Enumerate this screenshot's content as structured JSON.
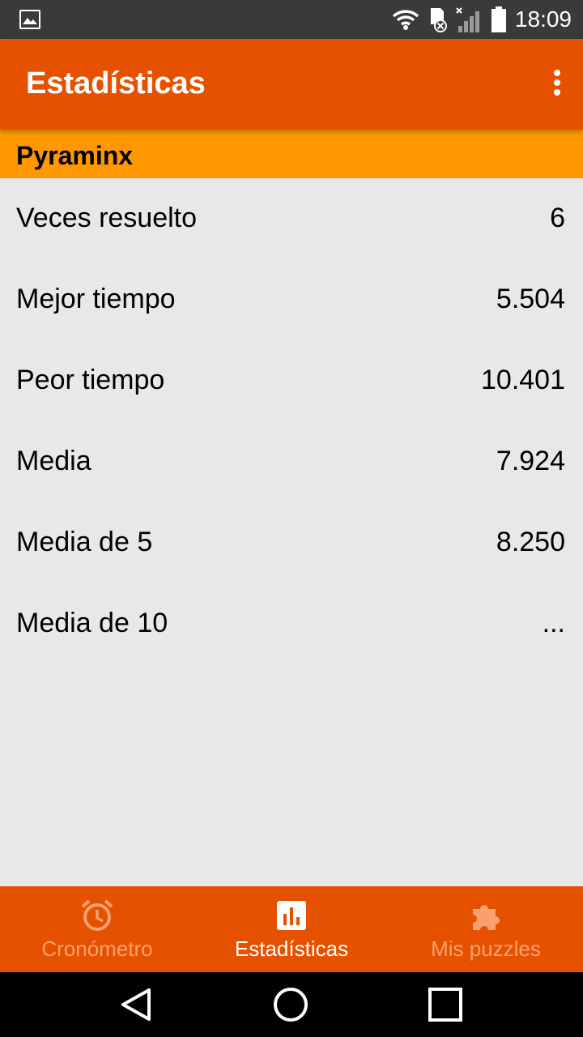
{
  "status_bar": {
    "time": "18:09",
    "icons": [
      "image-icon",
      "wifi-icon",
      "sd-card-icon",
      "signal-icon",
      "battery-icon"
    ]
  },
  "app_bar": {
    "title": "Estadísticas",
    "overflow_icon": "more-vert-icon"
  },
  "section": {
    "title": "Pyraminx"
  },
  "stats": [
    {
      "label": "Veces resuelto",
      "value": "6"
    },
    {
      "label": "Mejor tiempo",
      "value": "5.504"
    },
    {
      "label": "Peor tiempo",
      "value": "10.401"
    },
    {
      "label": "Media",
      "value": "7.924"
    },
    {
      "label": "Media de 5",
      "value": "8.250"
    },
    {
      "label": "Media de 10",
      "value": "..."
    }
  ],
  "bottom_nav": {
    "items": [
      {
        "label": "Cronómetro",
        "icon": "alarm-clock-icon",
        "active": false
      },
      {
        "label": "Estadísticas",
        "icon": "bar-chart-icon",
        "active": true
      },
      {
        "label": "Mis puzzles",
        "icon": "puzzle-icon",
        "active": false
      }
    ]
  },
  "colors": {
    "primary": "#e65100",
    "accent": "#ff9800",
    "background": "#e8e8e8",
    "inactive_nav": "#f8a070"
  }
}
